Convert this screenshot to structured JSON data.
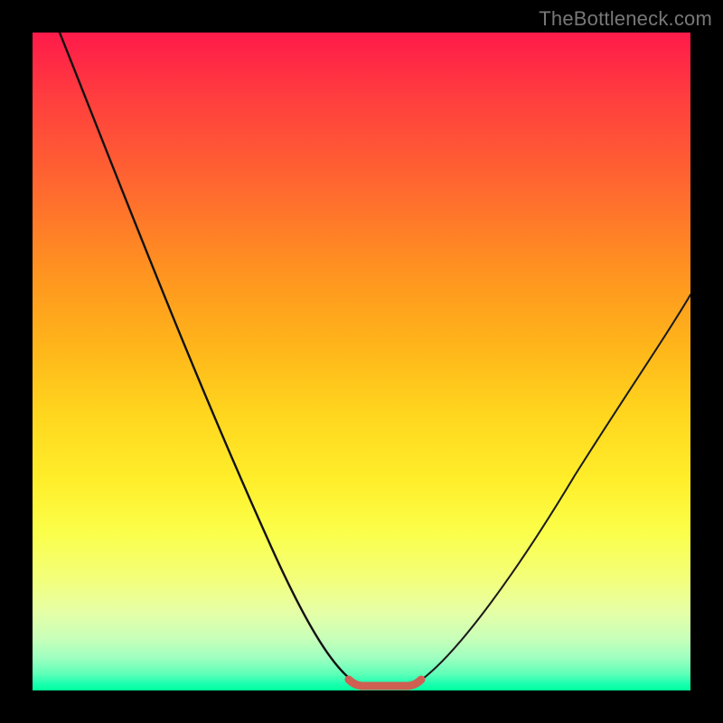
{
  "watermark": "TheBottleneck.com",
  "chart_data": {
    "type": "line",
    "title": "",
    "xlabel": "",
    "ylabel": "",
    "xlim": [
      0,
      100
    ],
    "ylim": [
      0,
      100
    ],
    "grid": false,
    "legend": false,
    "series": [
      {
        "name": "left-branch",
        "x": [
          4,
          10,
          16,
          22,
          28,
          34,
          40,
          44,
          47,
          49,
          50
        ],
        "y": [
          100,
          85,
          70,
          55,
          41,
          28,
          16,
          8,
          3,
          0.5,
          0
        ]
      },
      {
        "name": "right-branch",
        "x": [
          58,
          60,
          64,
          70,
          78,
          86,
          94,
          100
        ],
        "y": [
          0,
          1,
          5,
          13,
          25,
          38,
          51,
          61
        ]
      },
      {
        "name": "valley-floor",
        "x": [
          49,
          50,
          51,
          52,
          53,
          54,
          55,
          56,
          57,
          58
        ],
        "y": [
          0.5,
          0,
          0,
          0,
          0,
          0,
          0,
          0,
          0,
          0.5
        ]
      }
    ],
    "annotations": [
      {
        "name": "valley-highlight",
        "x_range": [
          49,
          58
        ],
        "color": "#d66a5a"
      }
    ]
  }
}
